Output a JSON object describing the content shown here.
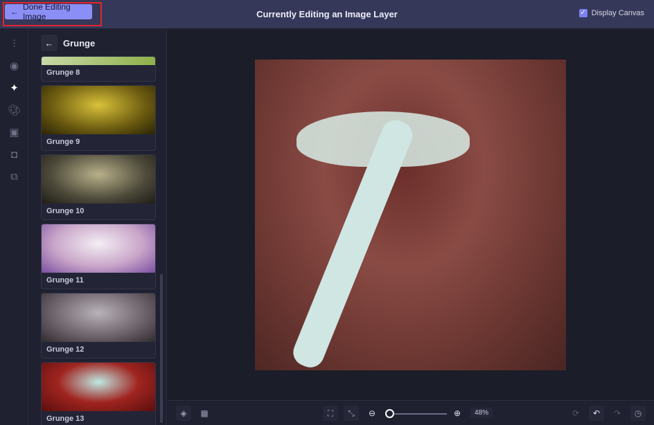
{
  "header": {
    "done_label": "Done Editing Image",
    "title": "Currently Editing an Image Layer",
    "display_canvas_label": "Display Canvas",
    "display_canvas_checked": true
  },
  "panel": {
    "title": "Grunge",
    "items": [
      {
        "label": "Grunge 8"
      },
      {
        "label": "Grunge 9"
      },
      {
        "label": "Grunge 10"
      },
      {
        "label": "Grunge 11"
      },
      {
        "label": "Grunge 12"
      },
      {
        "label": "Grunge 13"
      }
    ]
  },
  "toolbar": {
    "zoom_level": "48%"
  }
}
